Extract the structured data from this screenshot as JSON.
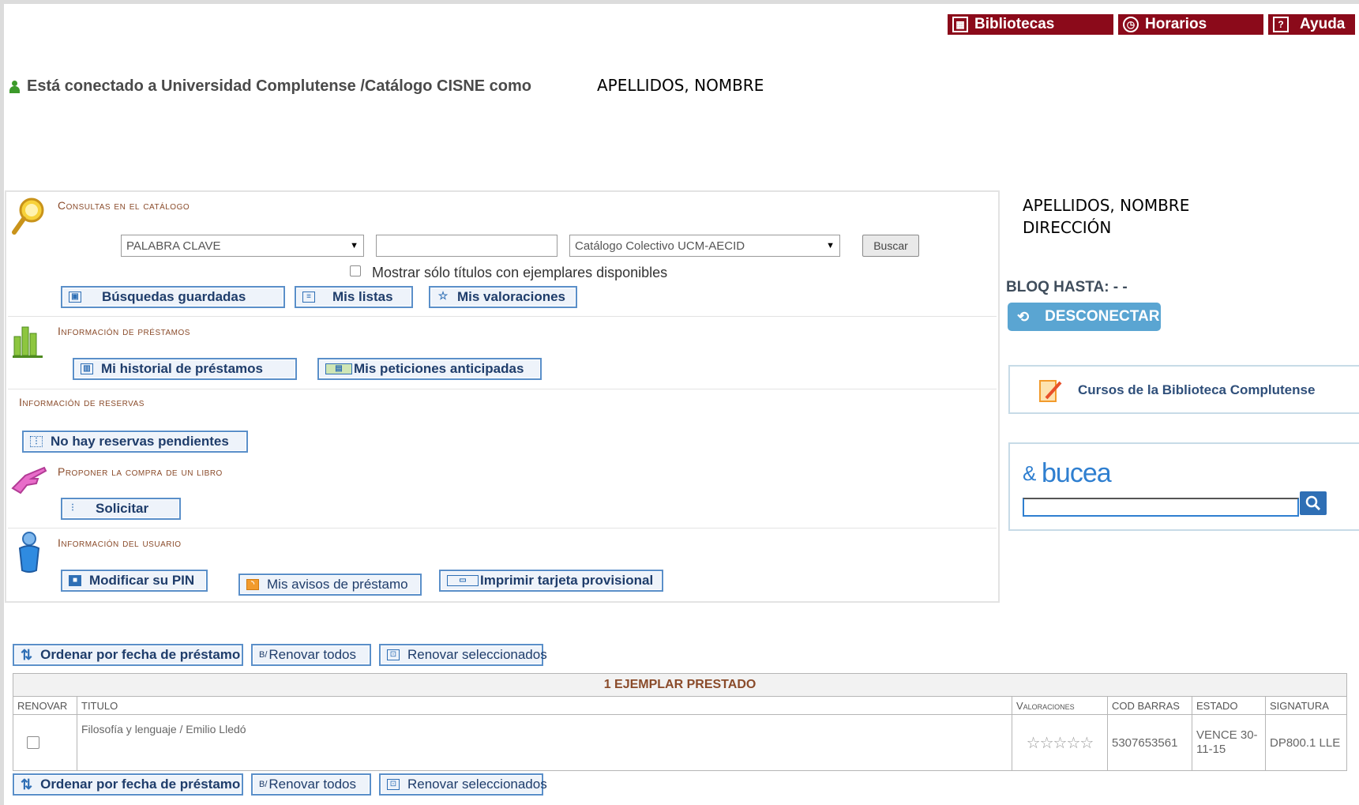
{
  "top_links": [
    {
      "label": "Bibliotecas",
      "icon": "building-icon"
    },
    {
      "label": "Horarios",
      "icon": "clock-icon"
    },
    {
      "label": "Ayuda",
      "icon": "help-book-icon"
    }
  ],
  "connection": {
    "text": "Está conectado a Universidad Complutense /Catálogo CISNE como",
    "user": "APELLIDOS, NOMBRE"
  },
  "catalog": {
    "heading": "Consultas en el catálogo",
    "search_type": "PALABRA CLAVE",
    "search_value": "",
    "scope": "Catálogo Colectivo UCM-AECID",
    "search_button": "Buscar",
    "available_only_label": "Mostrar sólo títulos con ejemplares disponibles",
    "buttons": [
      "Búsquedas guardadas",
      "Mis listas",
      "Mis valoraciones"
    ]
  },
  "loans_info": {
    "heading": "Información de préstamos",
    "buttons": [
      "Mi historial de préstamos",
      "Mis peticiones anticipadas"
    ]
  },
  "reserves": {
    "heading": "Información de reservas",
    "button": "No hay reservas pendientes"
  },
  "purchase": {
    "heading": "Proponer la compra de un libro",
    "button": "Solicitar"
  },
  "user_info": {
    "heading": "Información del usuario",
    "buttons": [
      "Modificar su PIN",
      "Mis avisos de préstamo",
      "Imprimir tarjeta provisional"
    ]
  },
  "sidebar": {
    "name": "APELLIDOS, NOMBRE",
    "address": "DIRECCIÓN",
    "bloq_label": "BLOQ HASTA: - -",
    "disconnect": "DESCONECTAR",
    "courses": "Cursos de la Biblioteca Complutense",
    "bucea_logo": "bucea",
    "bucea_search_value": ""
  },
  "loan_actions": [
    "Ordenar por fecha de préstamo",
    "Renovar todos",
    "Renovar seleccionados"
  ],
  "loans_table": {
    "caption": "1 EJEMPLAR PRESTADO",
    "headers": [
      "RENOVAR",
      "TITULO",
      "Valoraciones",
      "COD BARRAS",
      "ESTADO",
      "SIGNATURA"
    ],
    "rows": [
      {
        "title": "Filosofía y lenguaje / Emilio Lledó",
        "rating": 0,
        "barcode": "5307653561",
        "status": "VENCE 30-11-15",
        "signature": "DP800.1 LLE"
      }
    ]
  },
  "colors": {
    "brand_red": "#8b0a1a",
    "accent_blue": "#5a8fc9",
    "heading_brown": "#8a4b2a"
  }
}
